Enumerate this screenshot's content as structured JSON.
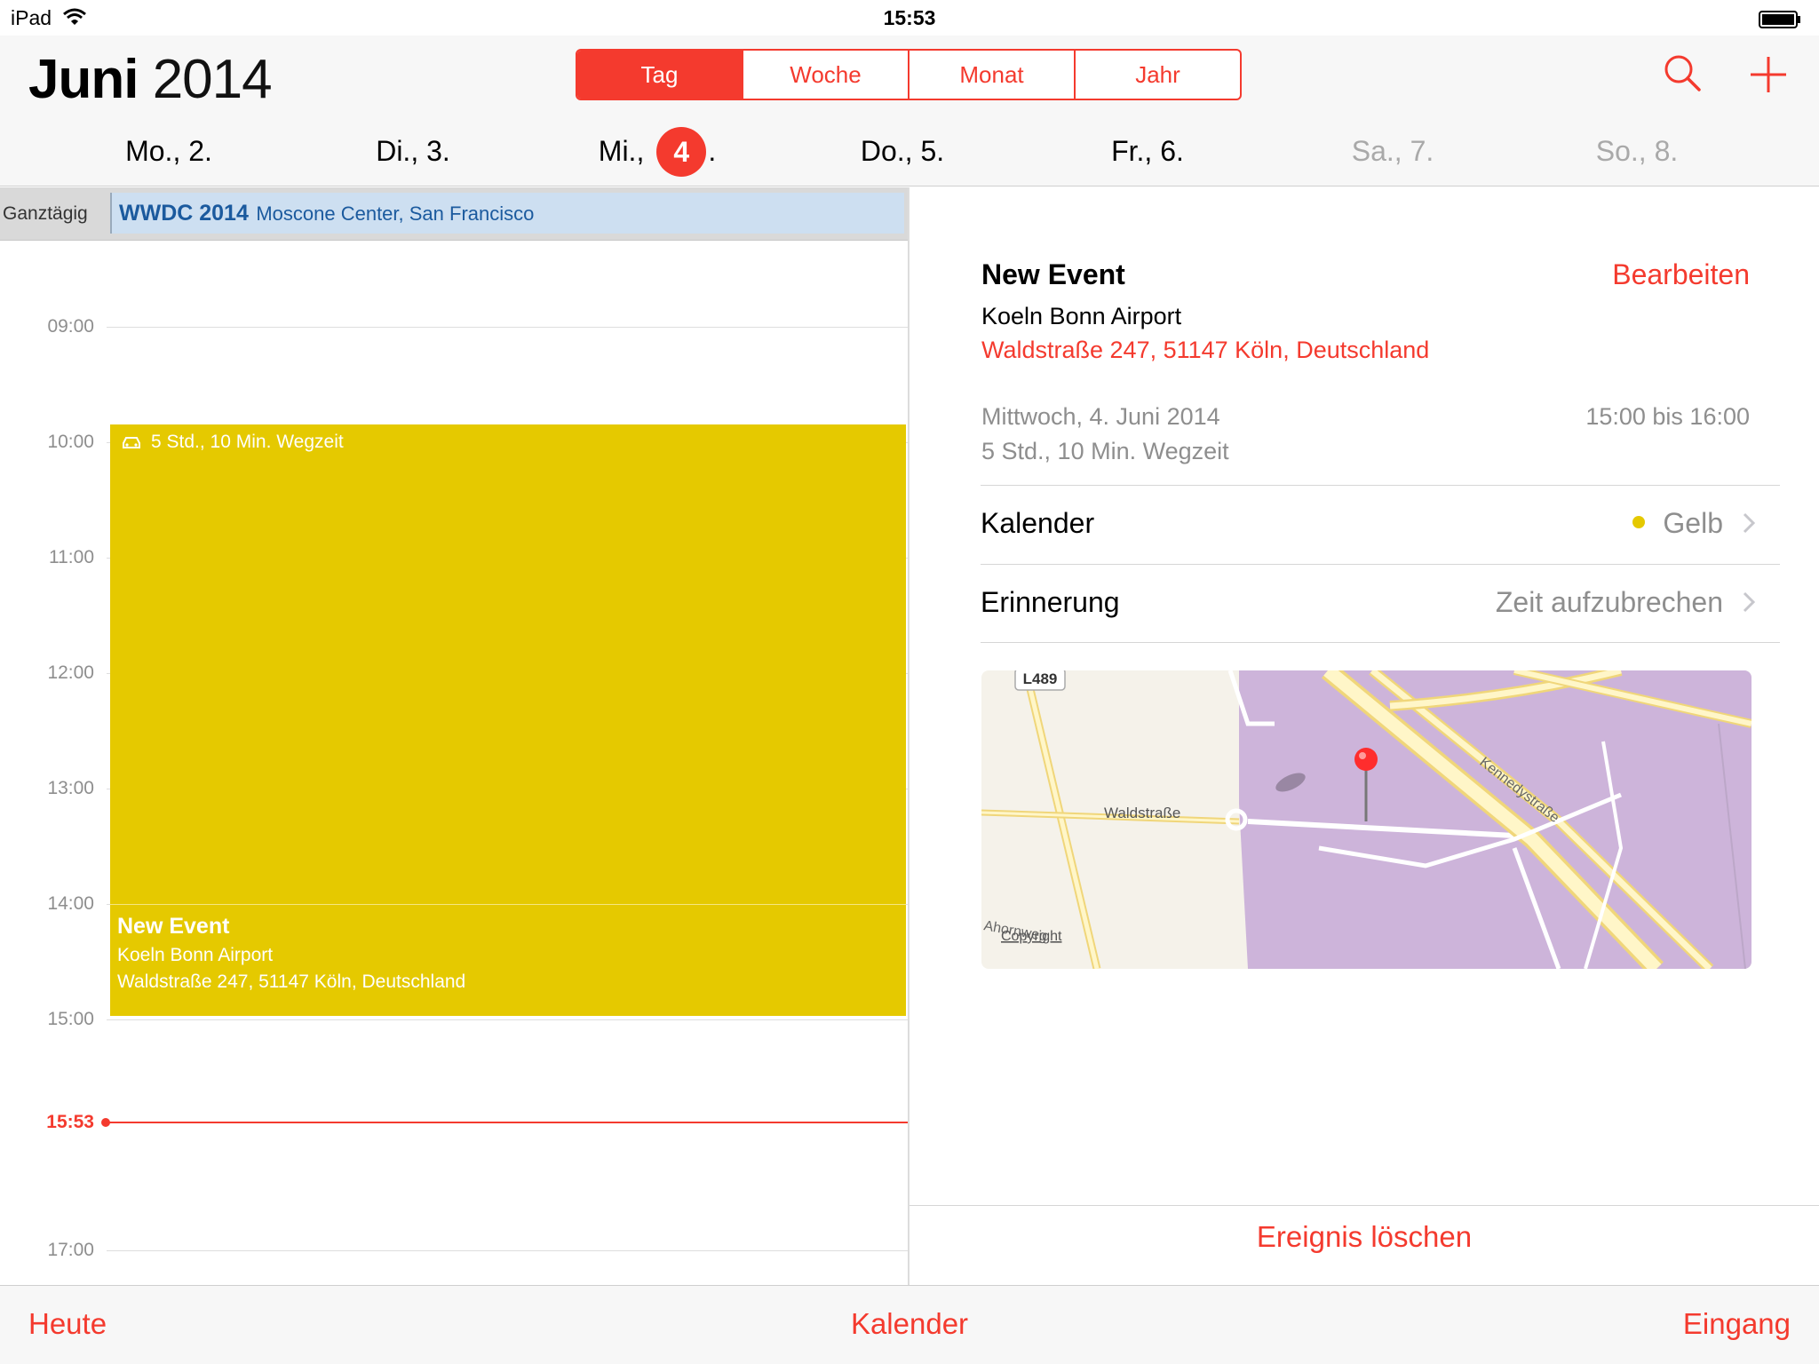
{
  "status_bar": {
    "device": "iPad",
    "time": "15:53"
  },
  "header": {
    "month": "Juni",
    "year": "2014",
    "view_tabs": [
      "Tag",
      "Woche",
      "Monat",
      "Jahr"
    ],
    "active_tab": "Tag",
    "accent_color": "#f43a2e"
  },
  "week": {
    "days": [
      {
        "label": "Mo., 2."
      },
      {
        "label": "Di., 3."
      },
      {
        "prefix": "Mi.,",
        "number": "4",
        "suffix": ".",
        "selected": true
      },
      {
        "label": "Do., 5."
      },
      {
        "label": "Fr., 6."
      },
      {
        "label": "Sa., 7.",
        "weekend": true
      },
      {
        "label": "So., 8.",
        "weekend": true
      }
    ]
  },
  "allday": {
    "label": "Ganztägig",
    "event_title": "WWDC 2014",
    "event_location": "Moscone Center, San Francisco"
  },
  "timeline": {
    "hours": [
      "09:00",
      "10:00",
      "11:00",
      "12:00",
      "13:00",
      "14:00",
      "15:00",
      "17:00"
    ],
    "current_time": "15:53",
    "travel_label": "5 Std., 10 Min. Wegzeit",
    "event": {
      "title": "New Event",
      "place": "Koeln Bonn Airport",
      "address": "Waldstraße 247, 51147 Köln, Deutschland"
    },
    "event_color": "#e5c900"
  },
  "detail": {
    "title": "New Event",
    "edit_label": "Bearbeiten",
    "place": "Koeln Bonn Airport",
    "address": "Waldstraße 247, 51147 Köln, Deutschland",
    "date": "Mittwoch, 4. Juni 2014",
    "time_range": "15:00 bis 16:00",
    "travel_time": "5 Std., 10 Min. Wegzeit",
    "calendar_label": "Kalender",
    "calendar_value": "Gelb",
    "reminder_label": "Erinnerung",
    "reminder_value": "Zeit aufzubrechen",
    "delete_label": "Ereignis löschen",
    "map": {
      "road_badge": "L489",
      "street_1": "Waldstraße",
      "street_2": "Kennedystraße",
      "street_3": "Ahornweg",
      "copyright": "Copyright"
    }
  },
  "toolbar": {
    "today": "Heute",
    "calendars": "Kalender",
    "inbox": "Eingang"
  }
}
